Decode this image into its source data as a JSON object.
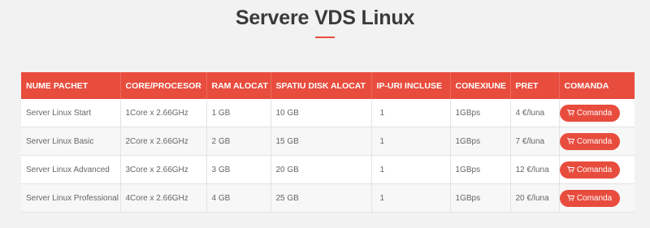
{
  "page": {
    "title": "Servere VDS Linux"
  },
  "table": {
    "headers": [
      "NUME PACHET",
      "CORE/PROCESOR",
      "RAM ALOCAT",
      "SPATIU DISK ALOCAT",
      "IP-URI INCLUSE",
      "CONEXIUNE",
      "PRET",
      "COMANDA"
    ],
    "rows": [
      {
        "name": "Server Linux Start",
        "cpu": "1Core x 2.66GHz",
        "ram": "1 GB",
        "disk": "10 GB",
        "ips": "1",
        "conn": "1GBps",
        "price": "4 €/luna",
        "button": "Comanda"
      },
      {
        "name": "Server Linux Basic",
        "cpu": "2Core x 2.66GHz",
        "ram": "2 GB",
        "disk": "15 GB",
        "ips": "1",
        "conn": "1GBps",
        "price": "7 €/luna",
        "button": "Comanda"
      },
      {
        "name": "Server Linux Advanced",
        "cpu": "3Core x 2.66GHz",
        "ram": "3 GB",
        "disk": "20 GB",
        "ips": "1",
        "conn": "1GBps",
        "price": "12 €/luna",
        "button": "Comanda"
      },
      {
        "name": "Server Linux Professional",
        "cpu": "4Core x 2.66GHz",
        "ram": "4 GB",
        "disk": "25 GB",
        "ips": "1",
        "conn": "1GBps",
        "price": "20 €/luna",
        "button": "Comanda"
      }
    ]
  },
  "colors": {
    "accent": "#e84c3d",
    "background": "#f2f2f2"
  },
  "icons": {
    "order": "shopping-cart-icon"
  }
}
